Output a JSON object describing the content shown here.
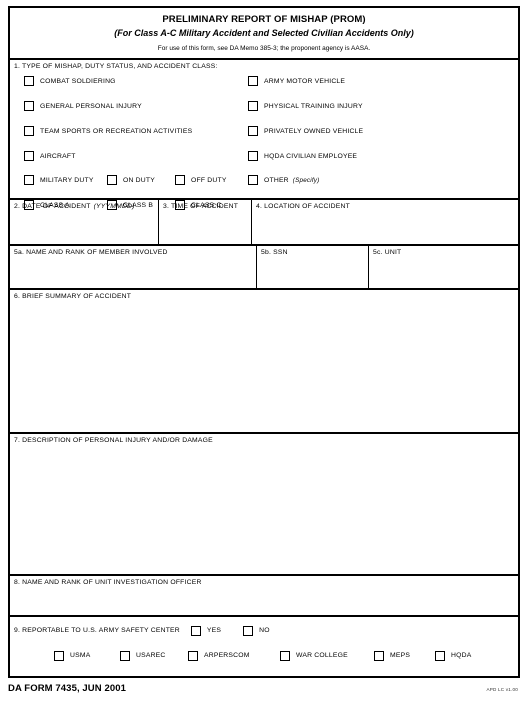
{
  "header": {
    "title": "PRELIMINARY REPORT OF MISHAP (PROM)",
    "subtitle": "(For Class A-C Military Accident and Selected Civilian Accidents Only)",
    "note": "For use of this form, see DA Memo 385-3; the proponent agency is AASA."
  },
  "section1": {
    "label": "1. TYPE OF MISHAP, DUTY STATUS, AND ACCIDENT CLASS:",
    "left_column": [
      "COMBAT SOLDIERING",
      "GENERAL PERSONAL INJURY",
      "TEAM SPORTS OR RECREATION ACTIVITIES",
      "AIRCRAFT"
    ],
    "right_column": [
      "ARMY MOTOR VEHICLE",
      "PHYSICAL TRAINING INJURY",
      "PRIVATELY OWNED VEHICLE",
      "HQDA CIVILIAN EMPLOYEE"
    ],
    "duty_row": [
      "MILITARY DUTY",
      "ON DUTY",
      "OFF DUTY"
    ],
    "other": {
      "label": "OTHER",
      "specify": "(Specify)"
    },
    "class_row": [
      "CLASS A",
      "CLASS B",
      "CLASS C"
    ]
  },
  "section2": {
    "label": "2. DATE OF ACCIDENT",
    "format_hint": "(YYYMMDD)",
    "value": ""
  },
  "section3": {
    "label": "3.  TIME OF ACCIDENT",
    "value": ""
  },
  "section4": {
    "label": "4.  LOCATION OF ACCIDENT",
    "value": ""
  },
  "section5a": {
    "label": "5a.  NAME AND RANK OF MEMBER INVOLVED",
    "value": ""
  },
  "section5b": {
    "label": "5b.  SSN",
    "value": ""
  },
  "section5c": {
    "label": "5c.  UNIT",
    "value": ""
  },
  "section6": {
    "label": "6.  BRIEF SUMMARY OF ACCIDENT",
    "value": ""
  },
  "section7": {
    "label": "7.  DESCRIPTION OF PERSONAL INJURY AND/OR DAMAGE",
    "value": ""
  },
  "section8": {
    "label": "8.  NAME AND RANK OF UNIT INVESTIGATION OFFICER",
    "value": ""
  },
  "section9": {
    "label": "9.  REPORTABLE TO U.S. ARMY SAFETY CENTER",
    "yes": "YES",
    "no": "NO",
    "agencies": [
      "USMA",
      "USAREC",
      "ARPERSCOM",
      "WAR COLLEGE",
      "MEPS",
      "HQDA"
    ]
  },
  "footer": {
    "form_id": "DA FORM 7435, JUN 2001",
    "apd_version": "APD LC v1.00"
  }
}
